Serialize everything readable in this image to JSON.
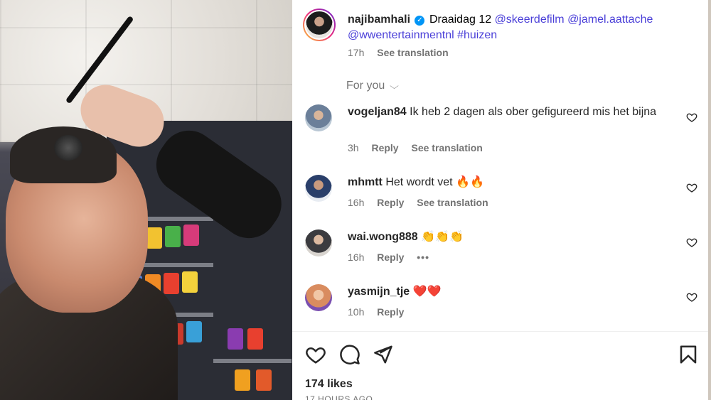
{
  "post": {
    "author": "najibamhali",
    "verified_mark": "✓",
    "caption_text": "Draaidag 12",
    "mentions": [
      "@skeerdefilm",
      "@jamel.aattache",
      "@wwentertainmentnl"
    ],
    "hashtag": "#huizen",
    "time": "17h",
    "see_translation": "See translation"
  },
  "filter": {
    "label": "For you"
  },
  "comments": [
    {
      "user": "vogeljan84",
      "text": "Ik heb 2 dagen als ober gefigureerd mis het bijna",
      "time": "3h",
      "reply": "Reply",
      "translate": "See translation",
      "avatar_color": "#9fb3c6"
    },
    {
      "user": "mhmtt",
      "text": "Het wordt vet 🔥🔥",
      "time": "16h",
      "reply": "Reply",
      "translate": "See translation",
      "avatar_color": "#3f5f8c"
    },
    {
      "user": "wai.wong888",
      "text": "👏👏👏",
      "time": "16h",
      "reply": "Reply",
      "more": "•••",
      "avatar_color": "#c8c2bb"
    },
    {
      "user": "yasmijn_tje",
      "text": "❤️❤️",
      "time": "10h",
      "reply": "Reply",
      "avatar_color": "#d98c5f"
    }
  ],
  "actions": {
    "like_icon": "heart-icon",
    "comment_icon": "comment-icon",
    "share_icon": "share-icon",
    "save_icon": "bookmark-icon"
  },
  "likes": "174 likes",
  "posted_ago": "17 HOURS AGO",
  "colors": {
    "link": "#4a3fd8",
    "muted": "#737373",
    "verified": "#0095f6"
  }
}
